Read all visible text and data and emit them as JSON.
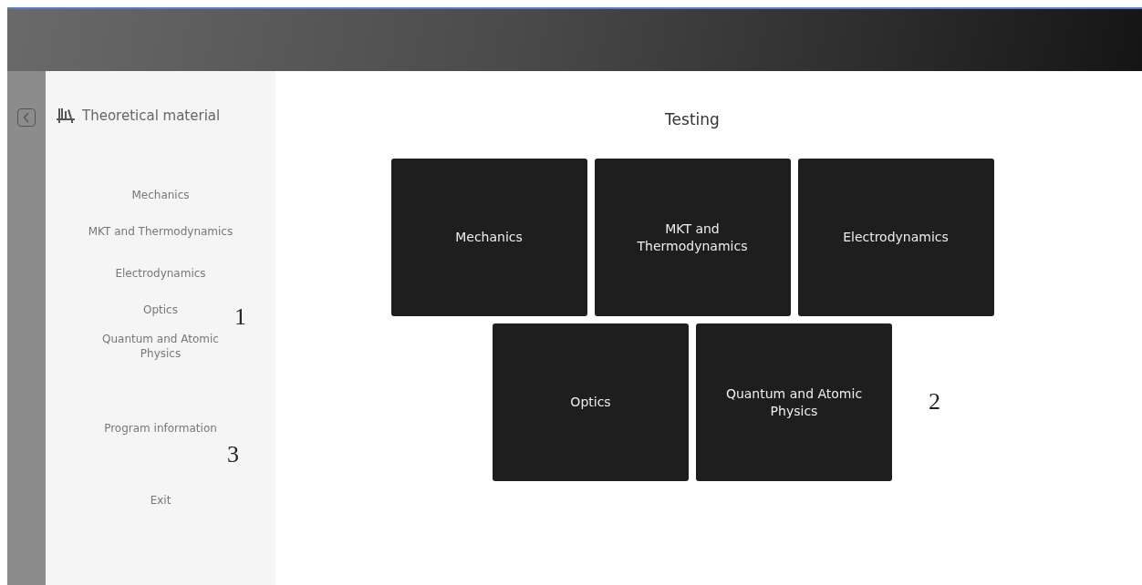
{
  "sidebar": {
    "title": "Theoretical material",
    "items": [
      {
        "label": "Mechanics"
      },
      {
        "label": "MKT and Thermodynamics"
      },
      {
        "label": "Electrodynamics"
      },
      {
        "label": "Optics"
      },
      {
        "label": "Quantum and Atomic Physics"
      }
    ],
    "program_info": "Program information",
    "exit": "Exit"
  },
  "main": {
    "title": "Testing",
    "tiles": [
      {
        "label": "Mechanics"
      },
      {
        "label": "MKT and Thermodynamics"
      },
      {
        "label": "Electrodynamics"
      },
      {
        "label": "Optics"
      },
      {
        "label": "Quantum and Atomic Physics"
      }
    ]
  },
  "annotations": [
    "1",
    "2",
    "3"
  ]
}
